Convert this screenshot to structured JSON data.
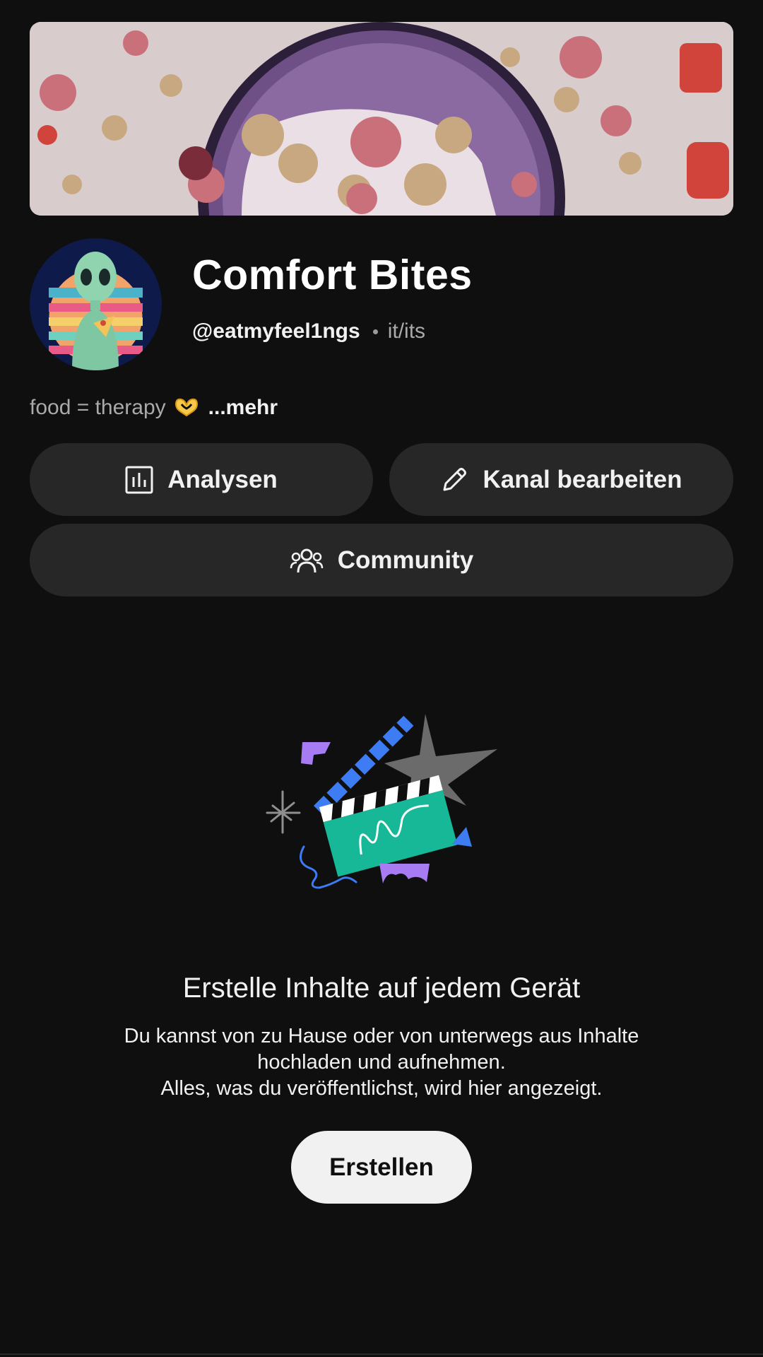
{
  "channel": {
    "name": "Comfort Bites",
    "handle": "@eatmyfeel1ngs",
    "pronouns": "it/its",
    "bio": "food = therapy",
    "bio_more": "...mehr"
  },
  "actions": {
    "analytics_label": "Analysen",
    "edit_label": "Kanal bearbeiten",
    "community_label": "Community"
  },
  "empty_state": {
    "title": "Erstelle Inhalte auf jedem Gerät",
    "description_lines": [
      "Du kannst von zu Hause oder von unterwegs aus Inhalte",
      "hochladen und aufnehmen.",
      "Alles, was du veröffentlichst, wird hier angezeigt."
    ],
    "create_label": "Erstellen"
  },
  "icons": {
    "bio_emoji": "heart-hands-emoji",
    "analytics": "bar-chart-icon",
    "edit": "pencil-icon",
    "community": "people-icon"
  },
  "colors": {
    "background": "#0f0f0f",
    "pill": "#272727",
    "primary_button": "#f1f1f1",
    "secondary_text": "#aaaaaa"
  }
}
